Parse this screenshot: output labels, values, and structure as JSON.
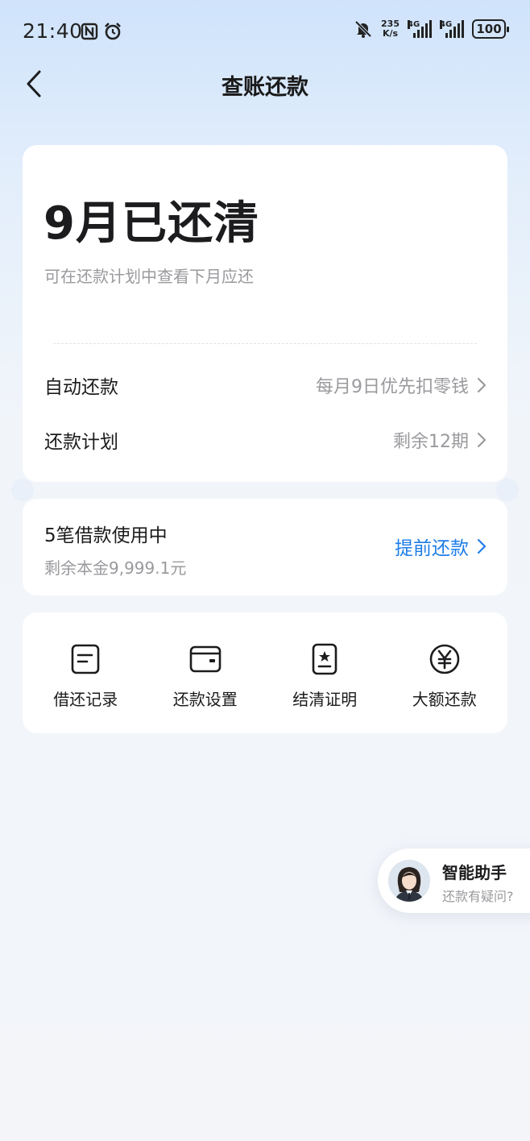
{
  "status_bar": {
    "time": "21:40",
    "net_speed_value": "235",
    "net_speed_unit": "K/s",
    "sim1_type": "4G",
    "sim2_type": "4G",
    "battery": "100",
    "icons": [
      "nfc-icon",
      "alarm-icon",
      "mute-bell-icon",
      "signal-icon",
      "signal-icon",
      "battery-icon"
    ]
  },
  "header": {
    "title": "查账还款"
  },
  "summary": {
    "status_title": "9月已还清",
    "hint": "可在还款计划中查看下月应还",
    "rows": [
      {
        "label": "自动还款",
        "value": "每月9日优先扣零钱"
      },
      {
        "label": "还款计划",
        "value": "剩余12期"
      }
    ]
  },
  "loan": {
    "title": "5笔借款使用中",
    "remaining": "剩余本金9,999.1元",
    "action": "提前还款",
    "action_color": "#1f7de8"
  },
  "tools": [
    {
      "label": "借还记录",
      "icon": "record-icon"
    },
    {
      "label": "还款设置",
      "icon": "wallet-icon"
    },
    {
      "label": "结清证明",
      "icon": "certificate-icon"
    },
    {
      "label": "大额还款",
      "icon": "yuan-icon"
    }
  ],
  "assistant": {
    "title": "智能助手",
    "subtitle": "还款有疑问?"
  }
}
